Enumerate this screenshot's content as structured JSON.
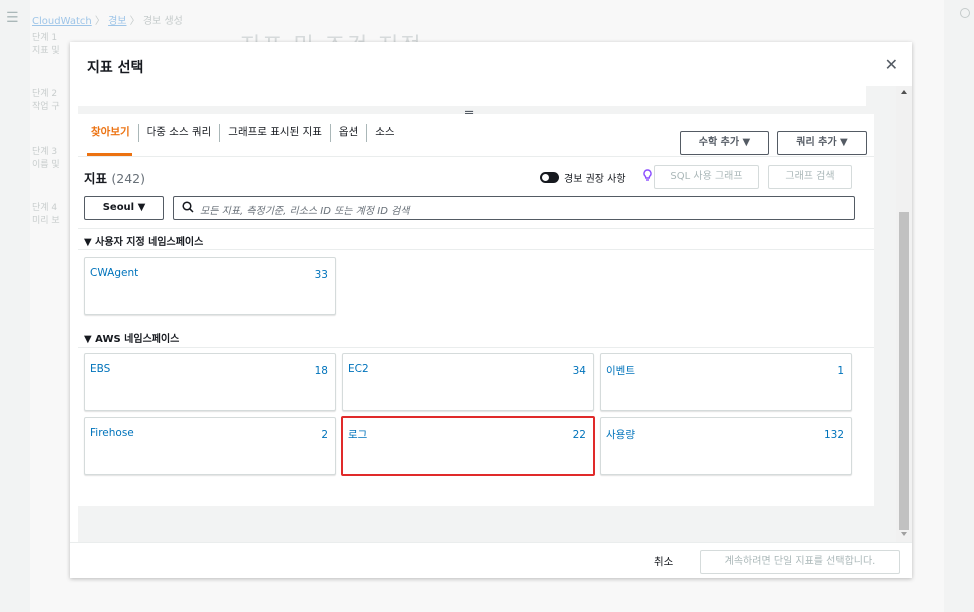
{
  "background": {
    "breadcrumb": [
      "CloudWatch",
      "경보",
      "경보 생성"
    ],
    "steps": [
      {
        "step": "단계 1",
        "label": "지표 및"
      },
      {
        "step": "단계 2",
        "label": "작업 구"
      },
      {
        "step": "단계 3",
        "label": "이름 및"
      },
      {
        "step": "단계 4",
        "label": "미리 보"
      }
    ],
    "page_title": "지표 및 조건 지정"
  },
  "modal": {
    "title": "지표 선택",
    "close_label": "✕",
    "tabs": [
      {
        "label": "찾아보기",
        "active": true
      },
      {
        "label": "다중 소스 쿼리"
      },
      {
        "label": "그래프로 표시된 지표"
      },
      {
        "label": "옵션"
      },
      {
        "label": "소스"
      }
    ],
    "buttons": {
      "math": "수학 추가 ▼",
      "query": "쿼리 추가 ▼",
      "sql": "SQL 사용 그래프",
      "graph_search": "그래프 검색"
    },
    "metrics": {
      "label": "지표",
      "count": "(242)"
    },
    "toggle_label": "경보 권장 사항",
    "region": "Seoul ▼",
    "search_placeholder": "모든 지표, 측정기준, 리소스 ID 또는 계정 ID 검색",
    "custom_namespace_header": "▼ 사용자 지정 네임스페이스",
    "custom_cards": [
      {
        "name": "CWAgent",
        "count": "33"
      }
    ],
    "aws_namespace_header": "▼ AWS 네임스페이스",
    "aws_cards": [
      {
        "name": "EBS",
        "count": "18"
      },
      {
        "name": "EC2",
        "count": "34"
      },
      {
        "name": "이벤트",
        "count": "1"
      },
      {
        "name": "Firehose",
        "count": "2"
      },
      {
        "name": "로그",
        "count": "22"
      },
      {
        "name": "사용량",
        "count": "132"
      }
    ],
    "footer": {
      "cancel": "취소",
      "continue": "계속하려면 단일 지표를 선택합니다."
    }
  },
  "colors": {
    "accent": "#ec7211",
    "link": "#0073bb",
    "highlight": "#e02a2a"
  }
}
